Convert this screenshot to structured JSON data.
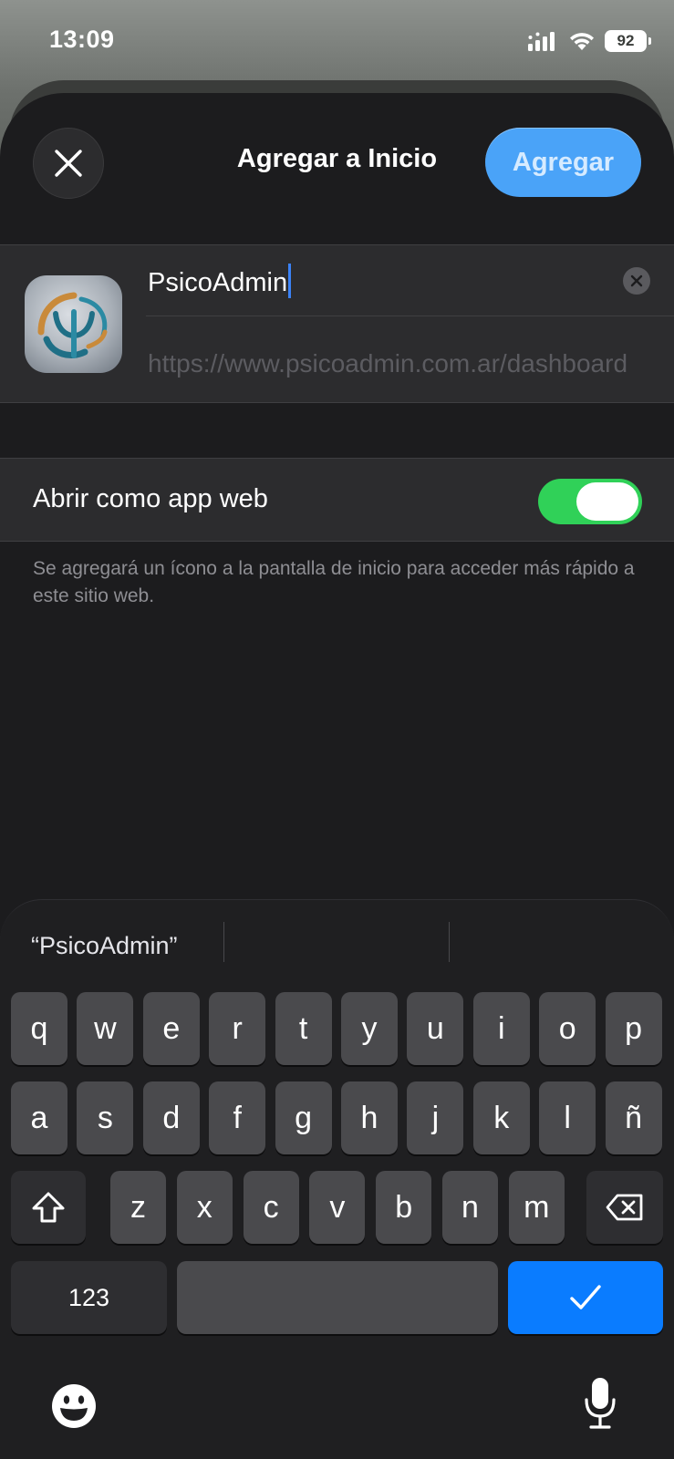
{
  "status": {
    "time": "13:09",
    "battery": "92"
  },
  "nav": {
    "title": "Agregar a Inicio",
    "add_label": "Agregar",
    "close_icon": "close-icon"
  },
  "bookmark": {
    "name": "PsicoAdmin",
    "url": "https://www.psicoadmin.com.ar/dashboard"
  },
  "settings": {
    "web_app_label": "Abrir como app web",
    "web_app_enabled": true,
    "footnote": "Se agregará un ícono a la pantalla de inicio para acceder más rápido a este sitio web."
  },
  "keyboard": {
    "suggestion": "“PsicoAdmin”",
    "row1": [
      "q",
      "w",
      "e",
      "r",
      "t",
      "y",
      "u",
      "i",
      "o",
      "p"
    ],
    "row2": [
      "a",
      "s",
      "d",
      "f",
      "g",
      "h",
      "j",
      "k",
      "l",
      "ñ"
    ],
    "row3": [
      "z",
      "x",
      "c",
      "v",
      "b",
      "n",
      "m"
    ],
    "numbers_label": "123",
    "accent_color": "#0a7cff",
    "toggle_color": "#30d158"
  }
}
